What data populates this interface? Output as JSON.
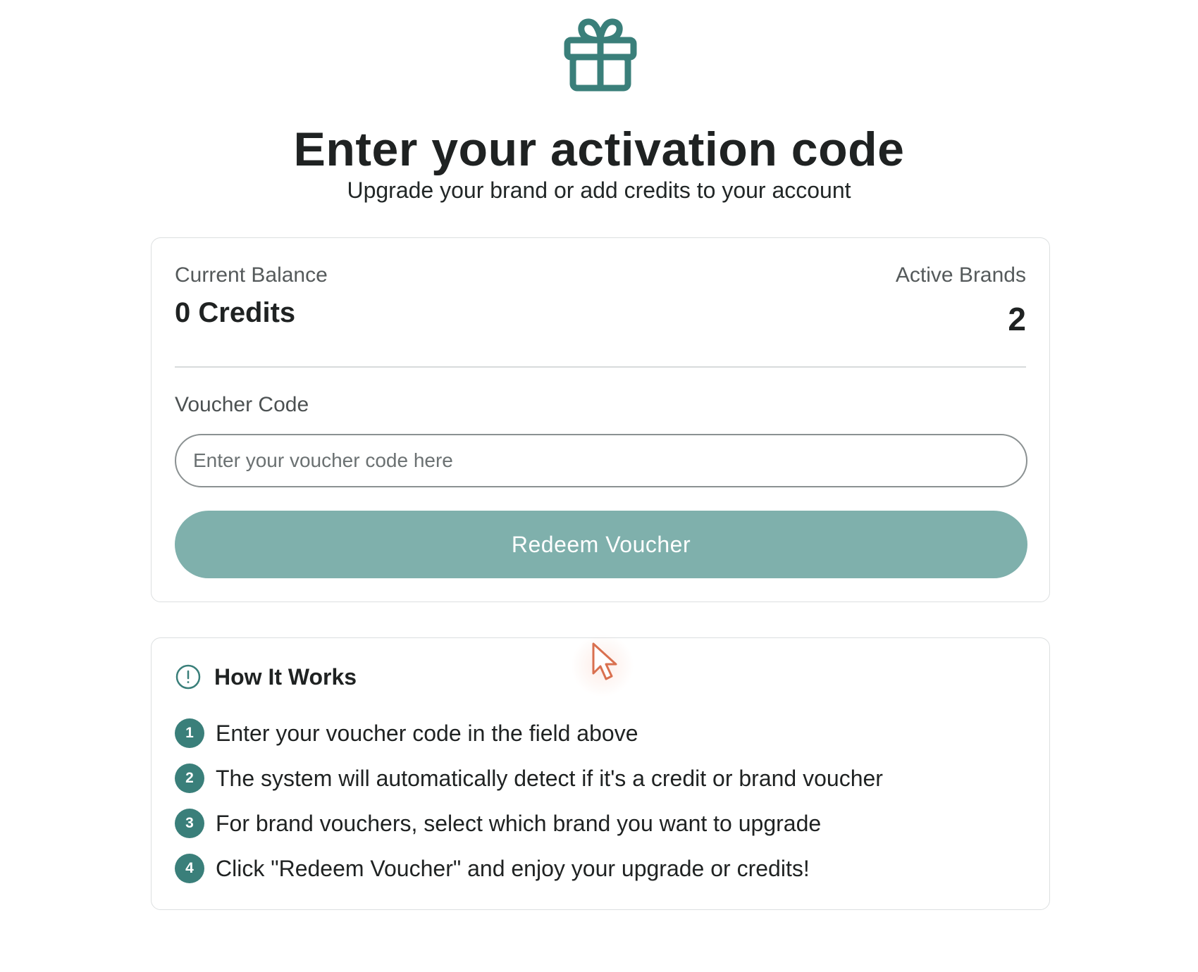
{
  "header": {
    "icon": "gift-icon",
    "title": "Enter your activation code",
    "subtitle": "Upgrade your brand or add credits to your account"
  },
  "balance_card": {
    "balance_label": "Current Balance",
    "balance_value": "0 Credits",
    "brands_label": "Active Brands",
    "brands_value": "2",
    "voucher_label": "Voucher Code",
    "voucher_value": "",
    "voucher_placeholder": "Enter your voucher code here",
    "redeem_label": "Redeem Voucher"
  },
  "how_it_works": {
    "icon": "info-circle-icon",
    "title": "How It Works",
    "steps": [
      {
        "number": "1",
        "text": "Enter your voucher code in the field above"
      },
      {
        "number": "2",
        "text": "The system will automatically detect if it's a credit or brand voucher"
      },
      {
        "number": "3",
        "text": "For brand vouchers, select which brand you want to upgrade"
      },
      {
        "number": "4",
        "text": "Click \"Redeem Voucher\" and enjoy your upgrade or credits!"
      }
    ]
  },
  "colors": {
    "accent": "#3a7f7a",
    "button_disabled": "#7fb0ac",
    "border": "#dcdfe0"
  }
}
